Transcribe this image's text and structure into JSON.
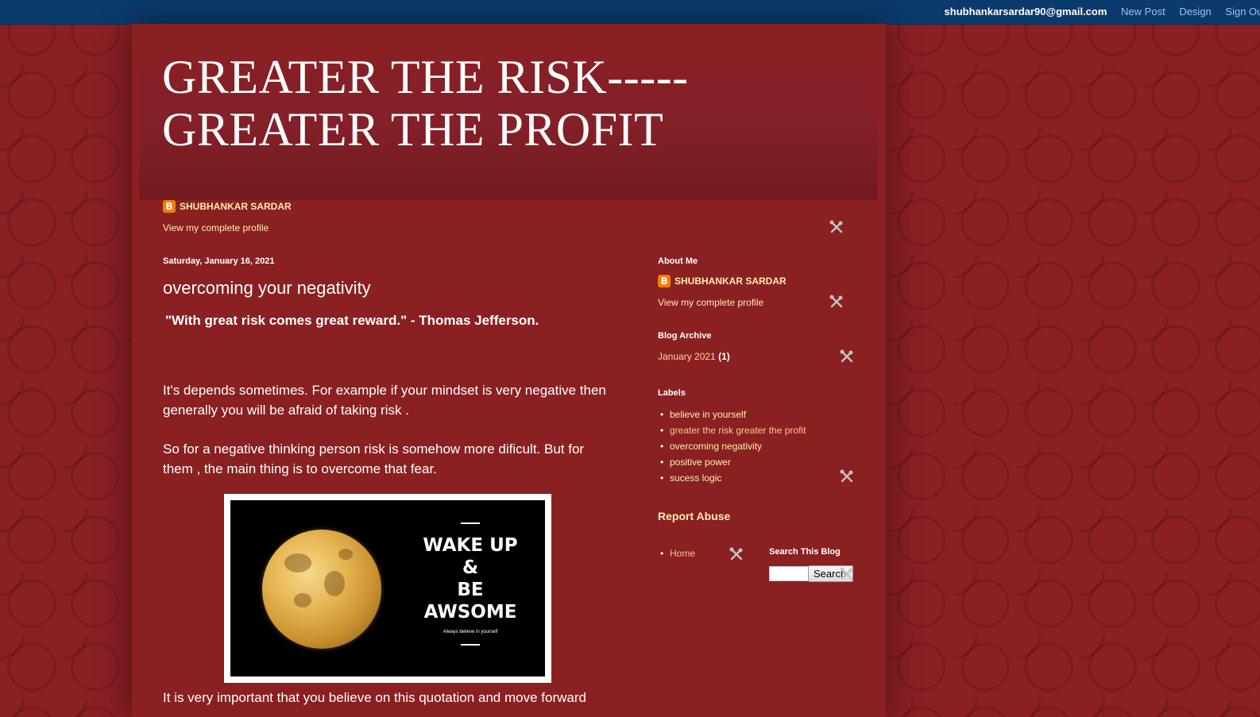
{
  "navbar": {
    "email": "shubhankarsardar90@gmail.com",
    "new_post": "New Post",
    "design": "Design",
    "sign_out": "Sign Out"
  },
  "header": {
    "title_line1": "GREATER THE RISK-----",
    "title_line2": "GREATER THE PROFIT"
  },
  "profile_top": {
    "name": "SHUBHANKAR SARDAR",
    "view_profile": "View my complete profile"
  },
  "post": {
    "date": "Saturday, January 16, 2021",
    "title": "overcoming your negativity",
    "quote": "\"With great risk comes great reward.\" - Thomas Jefferson.",
    "para1": "It's depends sometimes. For example if your mindset is very negative then generally you will be afraid of taking risk .",
    "para2": "So for a negative thinking person risk is somehow more dificult. But for them , the main thing is to overcome that fear.",
    "para3": "It is very important that you believe on this quotation and move forward",
    "image": {
      "line1": "WAKE UP",
      "line2": "&",
      "line3": "BE",
      "line4": "AWSOME",
      "caption": "Always believe in yourself"
    }
  },
  "sidebar": {
    "about": {
      "heading": "About Me",
      "name": "SHUBHANKAR SARDAR",
      "view_profile": "View my complete profile"
    },
    "archive": {
      "heading": "Blog Archive",
      "month": "January 2021",
      "count": "(1)"
    },
    "labels": {
      "heading": "Labels",
      "items": [
        "believe in yourself",
        "greater the risk greater the profit",
        "overcoming negativity",
        "positive power",
        "sucess logic"
      ]
    },
    "report_abuse": "Report Abuse",
    "pages": {
      "home": "Home"
    },
    "search": {
      "heading": "Search This Blog",
      "button": "Search",
      "value": ""
    }
  },
  "colors": {
    "background": "#8a1f24",
    "navbar": "#0b3a6e",
    "link": "#ffeeaa",
    "visited_link": "#ffc68c"
  }
}
